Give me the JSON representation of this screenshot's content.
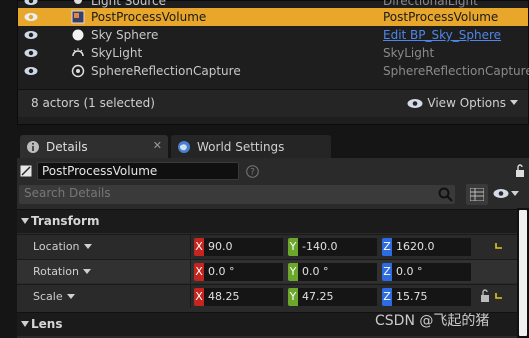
{
  "outliner": {
    "rows": [
      {
        "name": "Light Source",
        "type": "DirectionalLight",
        "icon": "bulb-icon",
        "selected": false
      },
      {
        "name": "PostProcessVolume",
        "type": "PostProcessVolume",
        "icon": "volume-icon",
        "selected": true
      },
      {
        "name": "Sky Sphere",
        "type": "Edit BP_Sky_Sphere",
        "icon": "sphere-icon",
        "selected": false,
        "link": true
      },
      {
        "name": "SkyLight",
        "type": "SkyLight",
        "icon": "skylight-icon",
        "selected": false
      },
      {
        "name": "SphereReflectionCapture",
        "type": "SphereReflectionCapture",
        "icon": "reflection-capture-icon",
        "selected": false
      }
    ],
    "actors_count": "8 actors (1 selected)",
    "view_options": "View Options"
  },
  "tabs": {
    "details": "Details",
    "world_settings": "World Settings"
  },
  "details": {
    "actor_name": "PostProcessVolume",
    "search_placeholder": "Search Details",
    "transform_label": "Transform",
    "lens_label": "Lens",
    "location": {
      "label": "Location",
      "x": "90.0",
      "y": "-140.0",
      "z": "1620.0"
    },
    "rotation": {
      "label": "Rotation",
      "x": "0.0 °",
      "y": "0.0 °",
      "z": "0.0 °"
    },
    "scale": {
      "label": "Scale",
      "x": "48.25",
      "y": "47.25",
      "z": "15.75"
    }
  },
  "watermark": "CSDN @飞起的猪",
  "colors": {
    "selection": "#e8a62a",
    "axis_x": "#c4261f",
    "axis_y": "#6aa72a",
    "axis_z": "#2f6be0",
    "link": "#4f86e7"
  }
}
